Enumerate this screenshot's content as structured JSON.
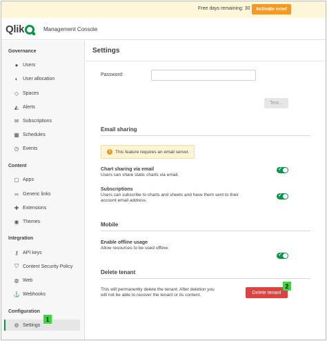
{
  "trial": {
    "text": "Free days remaining: 30",
    "activate_label": "Activate now!"
  },
  "brand": {
    "logo_text": "Qlik",
    "console_title": "Management Console",
    "accent_color": "#009845"
  },
  "sidebar": {
    "sections": [
      {
        "title": "Governance",
        "items": [
          {
            "label": "Users",
            "icon": "user-icon"
          },
          {
            "label": "User allocation",
            "icon": "user-allocation-icon"
          },
          {
            "label": "Spaces",
            "icon": "spaces-icon"
          },
          {
            "label": "Alerts",
            "icon": "alerts-icon"
          },
          {
            "label": "Subscriptions",
            "icon": "envelope-icon"
          },
          {
            "label": "Schedules",
            "icon": "calendar-icon"
          },
          {
            "label": "Events",
            "icon": "clock-icon"
          }
        ]
      },
      {
        "title": "Content",
        "items": [
          {
            "label": "Apps",
            "icon": "apps-icon"
          },
          {
            "label": "Generic links",
            "icon": "link-icon"
          },
          {
            "label": "Extensions",
            "icon": "puzzle-icon"
          },
          {
            "label": "Themes",
            "icon": "palette-icon"
          }
        ]
      },
      {
        "title": "Integration",
        "items": [
          {
            "label": "API keys",
            "icon": "key-icon"
          },
          {
            "label": "Content Security Policy",
            "icon": "shield-icon"
          },
          {
            "label": "Web",
            "icon": "globe-icon"
          },
          {
            "label": "Webhooks",
            "icon": "webhook-icon"
          }
        ]
      },
      {
        "title": "Configuration",
        "items": [
          {
            "label": "Settings",
            "icon": "gear-icon",
            "active": true
          }
        ]
      }
    ]
  },
  "main": {
    "title": "Settings",
    "password_label": "Password:",
    "password_value": "",
    "test_label": "Test...",
    "email_sharing": {
      "title": "Email sharing",
      "notice": "This feature requires an email server.",
      "chart_sharing_title": "Chart sharing via email",
      "chart_sharing_desc": "Users can share static charts via email.",
      "chart_sharing_on": true,
      "subscriptions_title": "Subscriptions",
      "subscriptions_desc_1": "Users can subscribe to charts and sheets and have them sent to their",
      "subscriptions_desc_2": "account email address.",
      "subscriptions_on": true
    },
    "mobile": {
      "title": "Mobile",
      "offline_title": "Enable offline usage",
      "offline_desc": "Allow resources to be used offline.",
      "offline_on": true
    },
    "delete_tenant": {
      "title": "Delete tenant",
      "desc_1": "This will permanently delete the tenant. After deletion you",
      "desc_2": "will not be able to recover the tenant or its content.",
      "button_label": "Delete tenant"
    }
  },
  "markers": {
    "one": "1",
    "two": "2"
  }
}
